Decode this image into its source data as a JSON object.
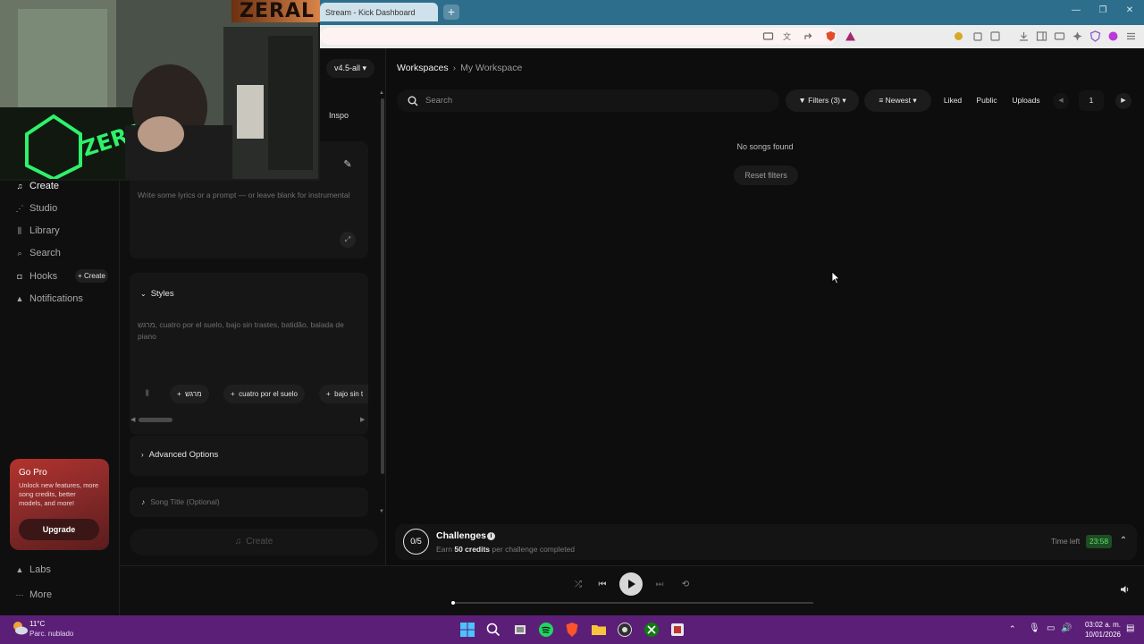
{
  "browser": {
    "tab_title": "Stream - Kick Dashboard",
    "new_tab_label": "+",
    "window_buttons": [
      "—",
      "❐",
      "✕"
    ]
  },
  "overlay": {
    "brand": "ZERAL"
  },
  "model": {
    "version": "v4.5-all"
  },
  "sidebar": {
    "items": [
      {
        "label": "Create",
        "icon": "music-note-icon"
      },
      {
        "label": "Studio",
        "icon": "studio-icon"
      },
      {
        "label": "Library",
        "icon": "library-icon"
      },
      {
        "label": "Search",
        "icon": "search-icon"
      },
      {
        "label": "Hooks",
        "icon": "hooks-icon"
      },
      {
        "label": "Notifications",
        "icon": "bell-icon"
      }
    ],
    "hooks_create": "+ Create",
    "gopro": {
      "title": "Go Pro",
      "description": "Unlock new features, more song credits, better models, and more!",
      "button": "Upgrade"
    },
    "bottom_items": [
      {
        "label": "Labs",
        "icon": "flask-icon"
      },
      {
        "label": "More",
        "icon": "more-icon"
      }
    ]
  },
  "create": {
    "inspo": "Inspo",
    "lyrics_placeholder": "Write some lyrics or a prompt — or leave blank for instrumental",
    "styles": {
      "title": "Styles",
      "placeholder": "מרגש, cuatro por el suelo, bajo sin trastes, batidão, balada de piano",
      "tags": [
        "מרגש",
        "cuatro por el suelo",
        "bajo sin t"
      ]
    },
    "advanced_options": "Advanced Options",
    "song_title_placeholder": "Song Title (Optional)",
    "create_button": "Create"
  },
  "workspace": {
    "breadcrumb": [
      "Workspaces",
      "My Workspace"
    ],
    "search_placeholder": "Search",
    "filters": "Filters (3)",
    "sort": "Newest",
    "toggles": [
      "Liked",
      "Public",
      "Uploads"
    ],
    "page": "1",
    "empty_message": "No songs found",
    "reset_filters": "Reset filters"
  },
  "challenges": {
    "count": "0/5",
    "title": "Challenges",
    "desc_prefix": "Earn",
    "desc_credits": "50 credits",
    "desc_suffix": "per challenge completed",
    "time_left_label": "Time left",
    "time_left_value": "23:58"
  },
  "taskbar": {
    "weather_temp": "11°C",
    "weather_desc": "Parc. nublado",
    "time": "03:02 a. m.",
    "date": "10/01/2026"
  },
  "colors": {
    "accent_green": "#61e06e",
    "gopro_red": "#b3332d",
    "browser_blue": "#2d6e8c",
    "taskbar_purple": "#5b1f77"
  }
}
